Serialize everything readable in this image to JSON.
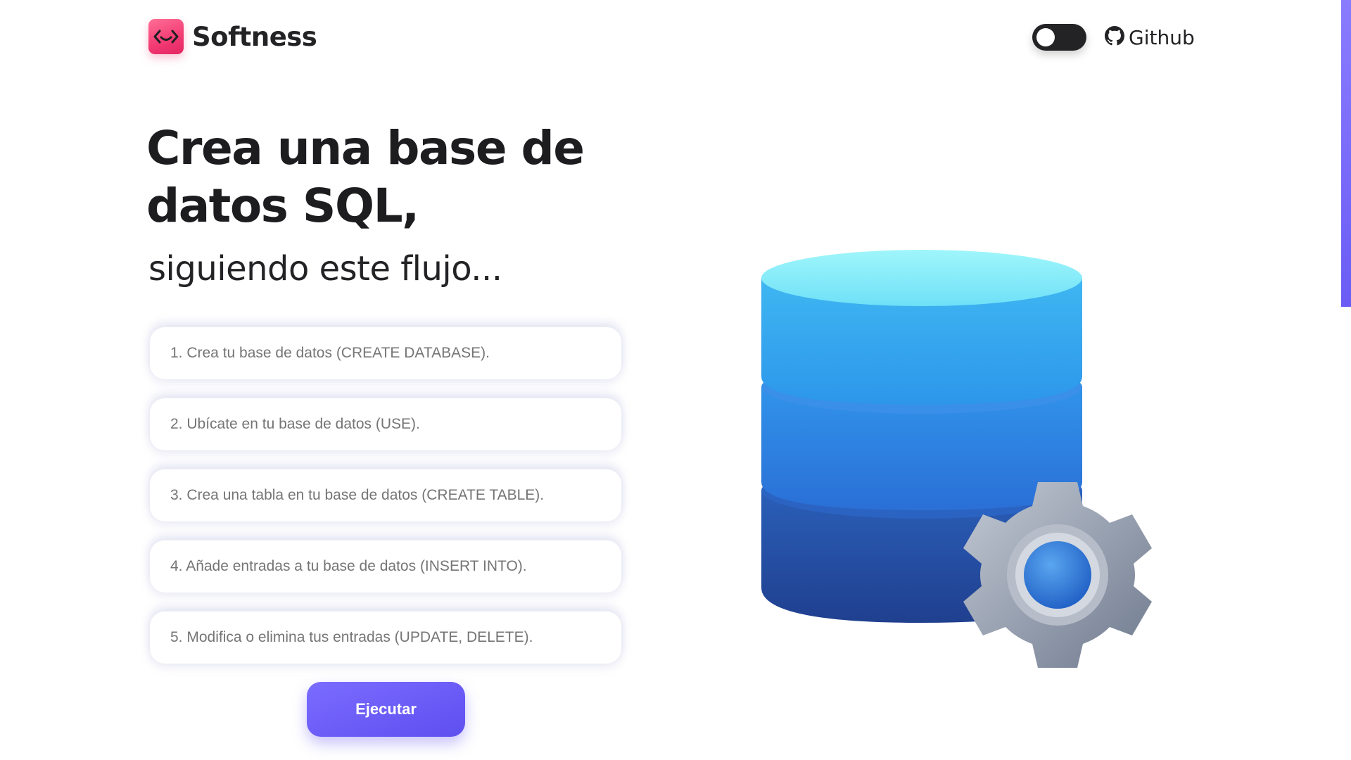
{
  "header": {
    "brand": "Softness",
    "logo_icon": "smile-code-icon",
    "theme_toggle": {
      "state": "off",
      "icon": "toggle-switch"
    },
    "github_link": {
      "label": "Github",
      "icon": "github-icon"
    }
  },
  "hero": {
    "title": "Crea una base de datos SQL,",
    "subtitle": "siguiendo este flujo..."
  },
  "steps": [
    {
      "placeholder": "1. Crea tu base de datos (CREATE DATABASE)."
    },
    {
      "placeholder": "2. Ubícate en tu base de datos (USE)."
    },
    {
      "placeholder": "3. Crea una tabla en tu base de datos (CREATE TABLE)."
    },
    {
      "placeholder": "4. Añade entradas a tu base de datos (INSERT INTO)."
    },
    {
      "placeholder": "5. Modifica o elimina tus entradas (UPDATE, DELETE)."
    }
  ],
  "actions": {
    "run_label": "Ejecutar"
  },
  "illustration": {
    "icon": "database-gear-icon"
  },
  "colors": {
    "logo_pink": "#f23a73",
    "button_purple": "#6b5cf5",
    "db_top": "#45c8f5",
    "db_middle": "#2f86e6",
    "db_bottom": "#2450a5",
    "gear_grey": "#8d96a8"
  }
}
